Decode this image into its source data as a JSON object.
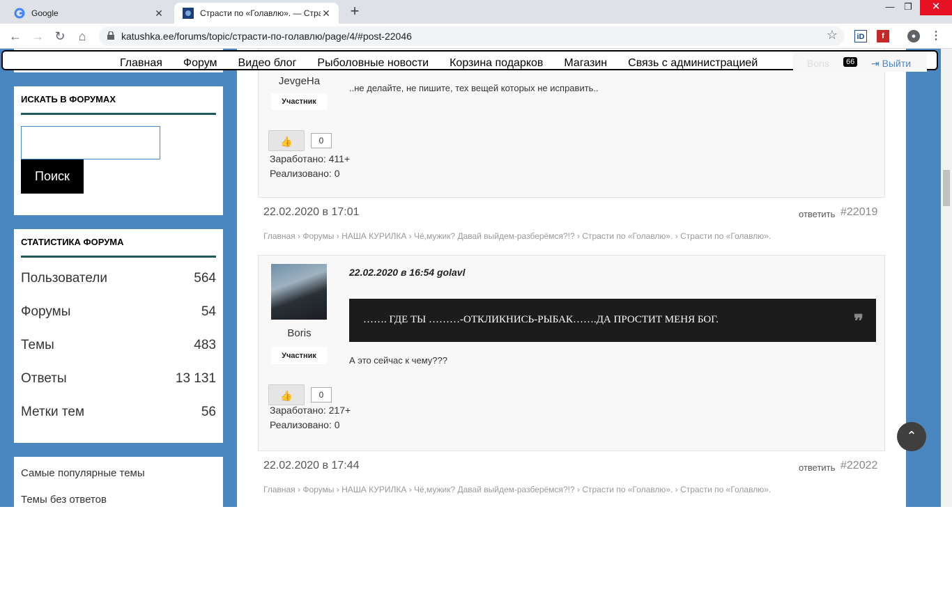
{
  "browser": {
    "tabs": [
      {
        "title": "Google"
      },
      {
        "title": "Страсти по «Голавлю». — Страс"
      }
    ],
    "new_tab": "+",
    "url": "katushka.ee/forums/topic/страсти-по-голавлю/page/4/#post-22046"
  },
  "site_nav": {
    "links": [
      "Главная",
      "Форум",
      "Видео блог",
      "Рыболовные новости",
      "Корзина подарков",
      "Магазин",
      "Связь с администрацией"
    ],
    "user": "Boris",
    "user_badge": "66",
    "logout": "Выйти"
  },
  "sidebar": {
    "search_title": "ИСКАТЬ В ФОРУМАХ",
    "search_button": "Поиск",
    "search_value": "",
    "stats_title": "СТАТИСТИКА ФОРУМА",
    "stats": [
      {
        "label": "Пользователи",
        "value": "564"
      },
      {
        "label": "Форумы",
        "value": "54"
      },
      {
        "label": "Темы",
        "value": "483"
      },
      {
        "label": "Ответы",
        "value": "13 131"
      },
      {
        "label": "Метки тем",
        "value": "56"
      }
    ],
    "links": [
      "Самые популярные темы",
      "Темы без ответов"
    ]
  },
  "posts": [
    {
      "author": "JevgeHa",
      "role": "Участник",
      "text": "..не делайте, не  пишите, тех вещей которых не исправить..",
      "likes": "0",
      "earned": "Заработано: 411+",
      "realized": "Реализовано: 0"
    },
    {
      "date": "22.02.2020 в 17:01",
      "reply": "ответить",
      "number": "#22019",
      "breadcrumb": "Главная › Форумы › НАША КУРИЛКА › Чё,мужик? Давай выйдем-разберёмся?!? › Страсти по «Голавлю». › Страсти по «Голавлю».",
      "author": "Boris",
      "role": "Участник",
      "quote_meta": "22.02.2020 в 16:54 golavl",
      "quote": "……. ГДЕ ТЫ ………-ОТКЛИКНИСЬ-РЫБАК…….ДА ПРОСТИТ МЕНЯ БОГ.",
      "text": "А это сейчас к чему???",
      "likes": "0",
      "earned": "Заработано: 217+",
      "realized": "Реализовано: 0"
    },
    {
      "date": "22.02.2020 в 17:44",
      "reply": "ответить",
      "number": "#22022",
      "breadcrumb": "Главная › Форумы › НАША КУРИЛКА › Чё,мужик? Давай выйдем-разберёмся?!? › Страсти по «Голавлю». › Страсти по «Голавлю»."
    }
  ],
  "colors": {
    "page_bg": "#4a86c0",
    "accent_line": "#1e5a5a",
    "quote_bg": "#1c1c1c"
  }
}
